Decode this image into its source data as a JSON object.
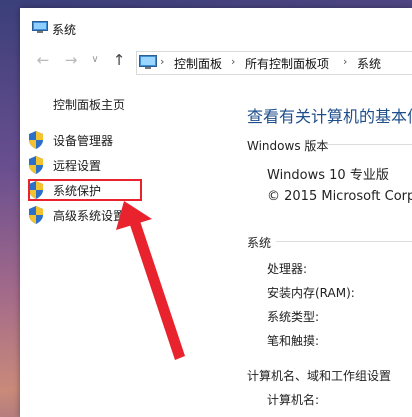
{
  "window": {
    "title": "系统",
    "title_icon": "computer-icon"
  },
  "navbar": {
    "back_icon": "arrow-left-icon",
    "forward_icon": "arrow-right-icon",
    "up_icon": "arrow-up-icon",
    "breadcrumb": [
      "控制面板",
      "所有控制面板项",
      "系统"
    ],
    "separator": "›"
  },
  "sidebar": {
    "home": "控制面板主页",
    "items": [
      {
        "label": "设备管理器",
        "icon": "shield-icon"
      },
      {
        "label": "远程设置",
        "icon": "shield-icon"
      },
      {
        "label": "系统保护",
        "icon": "shield-icon"
      },
      {
        "label": "高级系统设置",
        "icon": "shield-icon"
      }
    ]
  },
  "main": {
    "heading": "查看有关计算机的基本信",
    "windows_section": "Windows 版本",
    "edition": "Windows 10 专业版",
    "copyright": "© 2015 Microsoft Corpo",
    "system_section": "系统",
    "system_fields": [
      "处理器:",
      "安装内存(RAM):",
      "系统类型:",
      "笔和触摸:"
    ],
    "computer_section": "计算机名、域和工作组设置",
    "computer_fields": [
      "计算机名:"
    ]
  },
  "colors": {
    "highlight": "#e8232d",
    "heading": "#1e4e8c"
  }
}
